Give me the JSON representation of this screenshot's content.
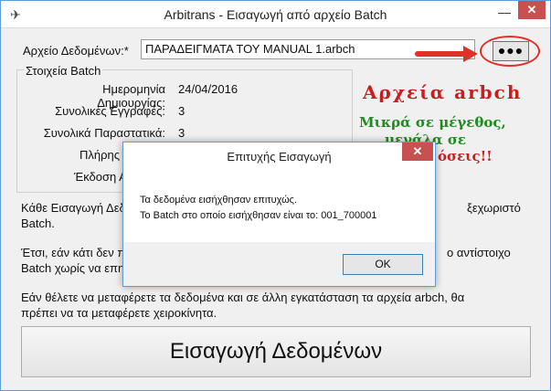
{
  "window": {
    "title": "Arbitrans - Εισαγωγή από αρχείο Batch",
    "minimize_glyph": "—",
    "close_glyph": "✕",
    "app_icon_glyph": "✈"
  },
  "file": {
    "label": "Αρχείο Δεδομένων:*",
    "value": "ΠΑΡΑΔΕΙΓΜΑΤΑ ΤΟΥ MANUAL 1.arbch",
    "browse_label": "●●●"
  },
  "batch_group": {
    "title": "Στοιχεία Batch",
    "fields": [
      {
        "label": "Ημερομηνία Δημιουργίας:",
        "value": "24/04/2016"
      },
      {
        "label": "Συνολικές Εγγραφές:",
        "value": "3"
      },
      {
        "label": "Συνολικά Παραστατικά:",
        "value": "3"
      },
      {
        "label": "Πλήρης Ον",
        "value": ""
      },
      {
        "label": "Έκδοση Α",
        "value": ""
      }
    ]
  },
  "promo": {
    "title": "Αρχεία arbch",
    "line1": "Μικρά σε μέγεθος,",
    "line2": "μεγάλα σε",
    "line3": "όσεις!!"
  },
  "description": {
    "p1_line1": "Κάθε Εισαγωγή Δεδ",
    "p1_line1_end": "ξεχωριστό",
    "p1_line2": "Batch.",
    "p2_line1": "Έτσι, εάν κάτι δεν π",
    "p2_line1_end": "ο αντίστοιχο",
    "p2_line2": "Batch χωρίς να επηρ",
    "p3_line1": "Εάν θέλετε να μεταφέρετε τα δεδομένα και σε άλλη εγκατάσταση τα αρχεία arbch, θα",
    "p3_line2": "πρέπει να τα μεταφέρετε χειροκίνητα."
  },
  "import_button": {
    "label": "Εισαγωγή Δεδομένων"
  },
  "dialog": {
    "title": "Επιτυχής Εισαγωγή",
    "message_line1": "Τα δεδομένα εισήχθησαν επιτυχώς.",
    "message_line2": "Το Batch στο οποίο εισήχθησαν είναι το: 001_700001",
    "ok_label": "OK",
    "close_glyph": "✕"
  },
  "colors": {
    "promo_red": "#c81e1e",
    "promo_green": "#1e8c1e",
    "close_red": "#c75050",
    "annotation_red": "#e0302a"
  }
}
